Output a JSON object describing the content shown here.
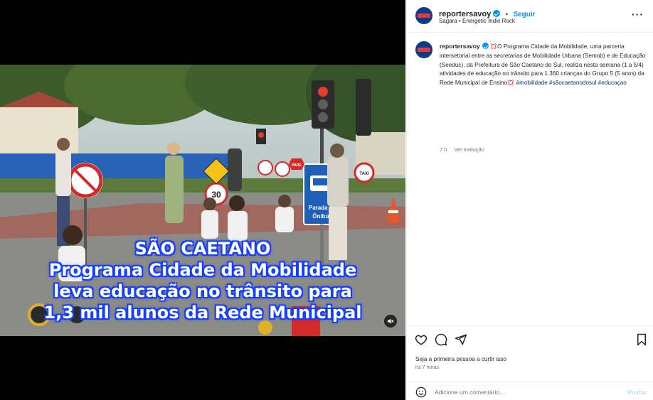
{
  "media": {
    "overlay_lines": [
      "SÃO CAETANO",
      "Programa Cidade da Mobilidade",
      "leva educação no trânsito para",
      "1,3 mil alunos da Rede Municipal"
    ],
    "signs": {
      "speed_limit": "30",
      "stop": "PARE",
      "taxi": "TAXI",
      "bus_stop_line1": "Parada de",
      "bus_stop_line2": "Ônibus"
    },
    "mute_icon": "speaker-muted-icon"
  },
  "header": {
    "username": "reportersavoy",
    "dot": "•",
    "follow_label": "Seguir",
    "audio": "Sagara • Energetic Indie Rock",
    "more_icon": "more-horizontal-icon"
  },
  "caption": {
    "username": "reportersavoy",
    "text": "💢O Programa Cidade da Mobilidade, uma parceria intersetorial entre as secretarias de Mobilidade Urbana (Semob) e de Educação (Seeduc), da Prefeitura de São Caetano do Sul, realiza nesta semana (1 a 5/4) atividades de educação no trânsito para 1.360 crianças do Grupo 5 (5 anos) da Rede Municipal de Ensino💢",
    "hashtags": "#mobilidade #sãocaetanodosul #educaçao",
    "age": "7 h",
    "translate_label": "Ver tradução"
  },
  "actions": {
    "icons": [
      "heart-icon",
      "comment-icon",
      "share-icon",
      "bookmark-icon"
    ],
    "likes_text": "Seja a primeira pessoa a curtir isso",
    "time_text": "há 7 horas"
  },
  "add_comment": {
    "emoji_icon": "emoji-icon",
    "placeholder": "Adicione um comentário...",
    "post_label": "Postar"
  },
  "colors": {
    "accent": "#0095f6",
    "hashtag": "#00376b",
    "overlay_glow": "#1a3cff"
  }
}
